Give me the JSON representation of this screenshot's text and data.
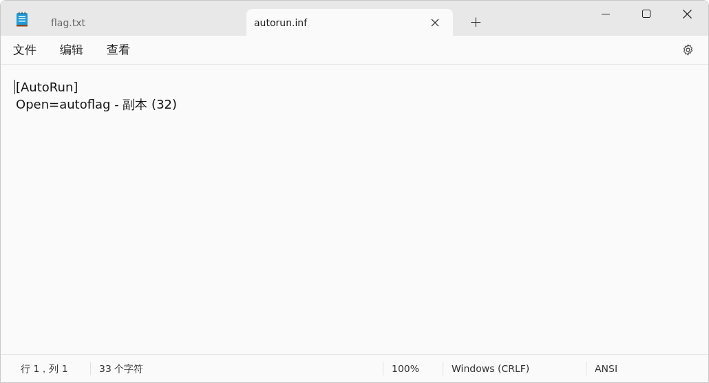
{
  "tabs": [
    {
      "label": "flag.txt",
      "selected": false,
      "closable": false
    },
    {
      "label": "autorun.inf",
      "selected": true,
      "closable": true
    }
  ],
  "new_tab": "+",
  "menu": [
    "文件",
    "编辑",
    "查看"
  ],
  "editor": {
    "lines": [
      "[AutoRun]",
      "Open=autoflag - 副本 (32)"
    ]
  },
  "status_bar": {
    "position": "行 1，列 1",
    "characters": "33 个字符",
    "zoom": "100%",
    "line_ending": "Windows (CRLF)",
    "encoding": "ANSI"
  }
}
